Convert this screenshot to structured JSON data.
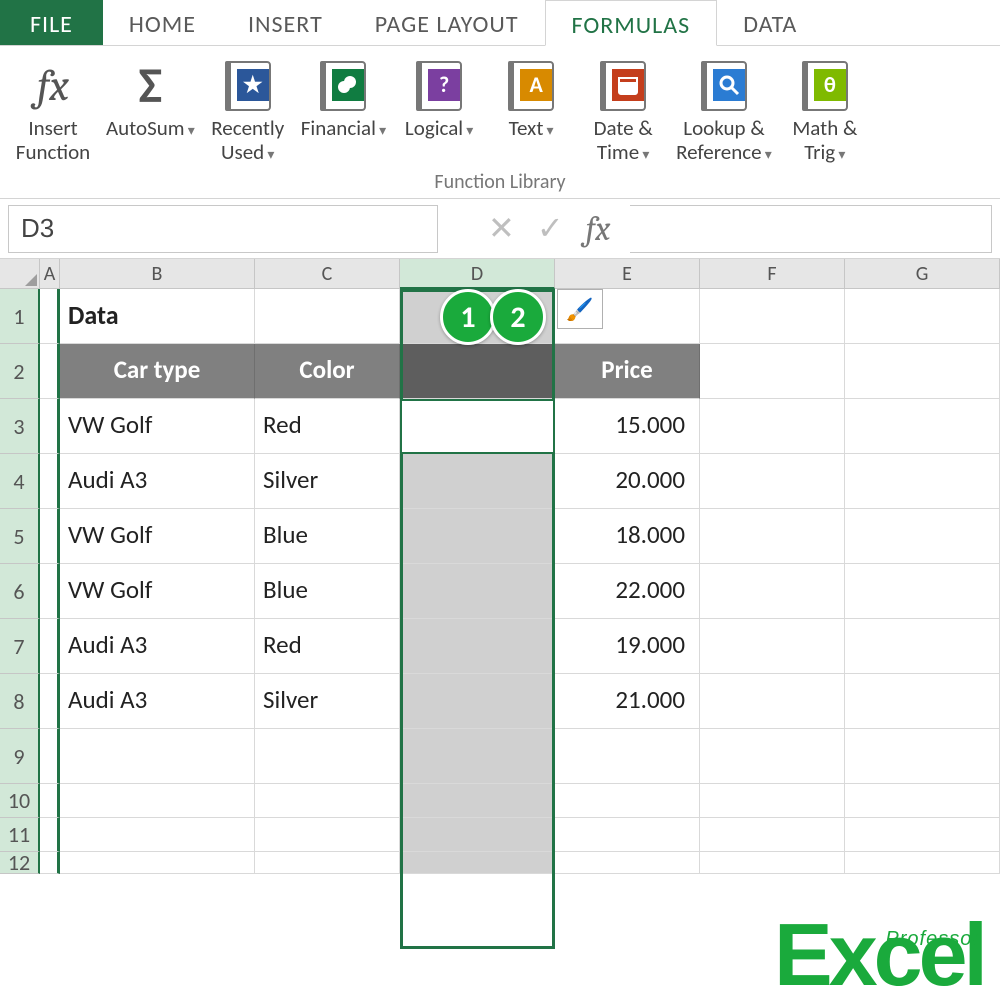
{
  "ribbon": {
    "tabs": {
      "file": "FILE",
      "home": "HOME",
      "insert": "INSERT",
      "page_layout": "PAGE LAYOUT",
      "formulas": "FORMULAS",
      "data": "DATA"
    },
    "buttons": {
      "insert_function": "Insert\nFunction",
      "autosum": "AutoSum",
      "recently_used": "Recently\nUsed",
      "financial": "Financial",
      "logical": "Logical",
      "text": "Text",
      "date_time": "Date &\nTime",
      "lookup_ref": "Lookup &\nReference",
      "math_trig": "Math &\nTrig"
    },
    "group_caption": "Function Library"
  },
  "name_box": "D3",
  "columns": [
    "A",
    "B",
    "C",
    "D",
    "E",
    "F",
    "G"
  ],
  "row_numbers": [
    "1",
    "2",
    "3",
    "4",
    "5",
    "6",
    "7",
    "8",
    "9",
    "10",
    "11",
    "12"
  ],
  "sheet": {
    "title": "Data",
    "headers": {
      "car_type": "Car type",
      "color": "Color",
      "price": "Price"
    },
    "rows": [
      {
        "car_type": "VW Golf",
        "color": "Red",
        "price": "15.000"
      },
      {
        "car_type": "Audi A3",
        "color": "Silver",
        "price": "20.000"
      },
      {
        "car_type": "VW Golf",
        "color": "Blue",
        "price": "18.000"
      },
      {
        "car_type": "VW Golf",
        "color": "Blue",
        "price": "22.000"
      },
      {
        "car_type": "Audi A3",
        "color": "Red",
        "price": "19.000"
      },
      {
        "car_type": "Audi A3",
        "color": "Silver",
        "price": "21.000"
      }
    ]
  },
  "callouts": {
    "one": "1",
    "two": "2"
  },
  "logo": {
    "big": "Excel",
    "small": "Professor"
  }
}
